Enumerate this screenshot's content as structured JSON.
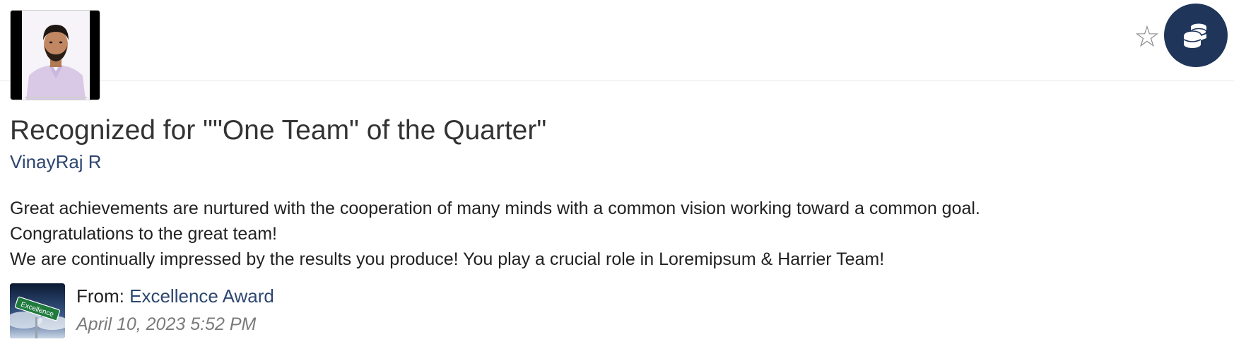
{
  "recognition": {
    "title": "Recognized for \"\"One Team\" of the Quarter\"",
    "recipient": "VinayRaj R",
    "message_lines": [
      "Great achievements are nurtured with the cooperation of many minds with a common vision working toward a common goal.",
      "Congratulations to the great team!",
      "We are continually impressed by the results you produce! You play a crucial role in Loremipsum & Harrier Team!"
    ],
    "from_label": "From:",
    "from_name": "Excellence Award",
    "timestamp": "April 10, 2023 5:52 PM"
  },
  "actions": {
    "favorite_icon": "star-outline-icon",
    "points_icon": "coins-icon"
  },
  "award_image": {
    "sign_text": "Excellence"
  },
  "colors": {
    "link": "#2d4670",
    "coins_button_bg": "#1f3559",
    "text": "#333333",
    "timestamp": "#7a7a7a"
  }
}
